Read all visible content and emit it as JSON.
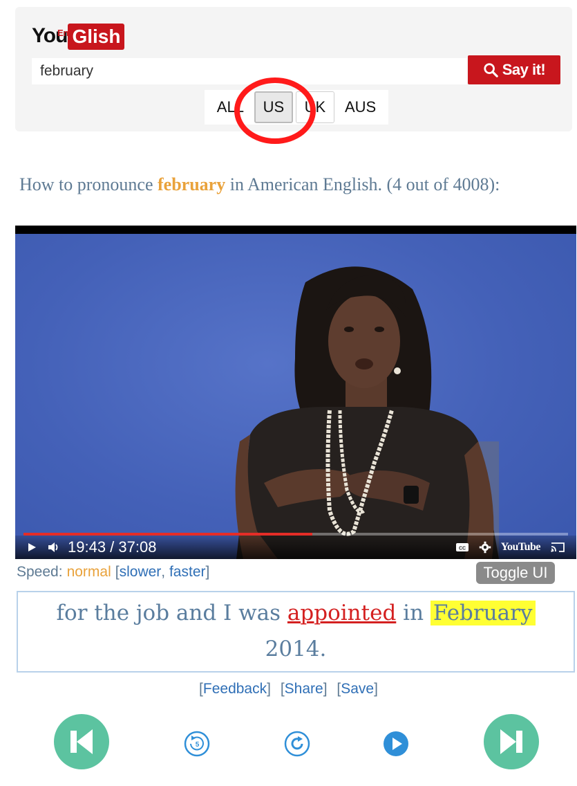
{
  "logo": {
    "you": "You",
    "en": "En",
    "glish": "Glish"
  },
  "search": {
    "value": "february",
    "button_label": "Say it!"
  },
  "accents": [
    {
      "label": "ALL",
      "selected": false
    },
    {
      "label": "US",
      "selected": true
    },
    {
      "label": "UK",
      "selected": false
    },
    {
      "label": "AUS",
      "selected": false
    }
  ],
  "title": {
    "prefix": "How to pronounce ",
    "word": "february",
    "suffix": " in American English. (4 out of 4008):"
  },
  "video": {
    "time": "19:43 / 37:08",
    "progress": 0.53,
    "youtube_label": "YouTube"
  },
  "speed": {
    "label": "Speed:",
    "current": "normal",
    "slower": "slower",
    "faster": "faster",
    "toggle_label": "Toggle UI"
  },
  "caption": {
    "before": "for the job and I was ",
    "highlight_word": "appointed",
    "middle": " in ",
    "keyword": "February",
    "after": "2014."
  },
  "links": {
    "feedback": "Feedback",
    "share": "Share",
    "save": "Save"
  },
  "colors": {
    "brand_red": "#c8161d",
    "nav_green": "#5cc3a0",
    "link_blue": "#2f6fb6",
    "highlight_yellow": "#ffff33"
  },
  "icons": {
    "search": "search-icon",
    "play": "play-icon",
    "volume": "volume-icon",
    "captions": "captions-icon",
    "settings": "gear-icon",
    "cast": "cast-icon",
    "previous": "skip-previous-icon",
    "rewind": "rewind-5-icon",
    "replay": "replay-icon",
    "play_small": "play-circle-icon",
    "next": "skip-next-icon"
  }
}
